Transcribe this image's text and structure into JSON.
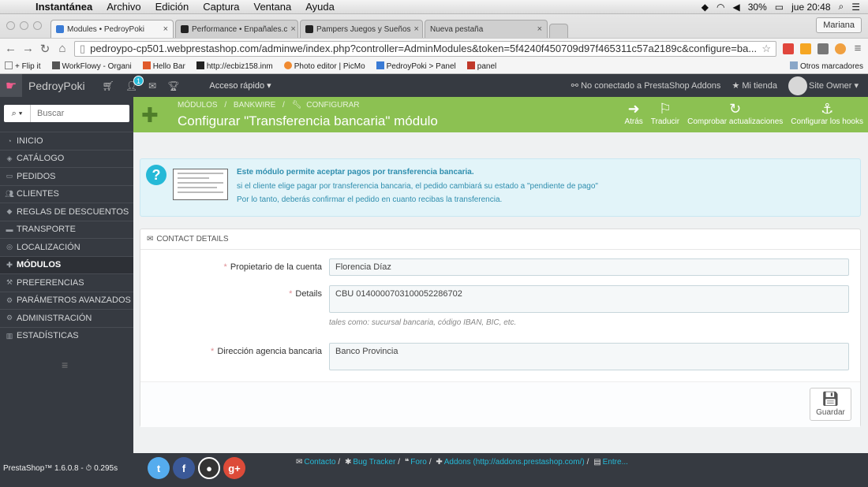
{
  "mac_menu": {
    "app": "Instantánea",
    "items": [
      "Archivo",
      "Edición",
      "Captura",
      "Ventana",
      "Ayuda"
    ],
    "battery": "30%",
    "clock": "jue 20:48"
  },
  "browser": {
    "tabs": [
      {
        "label": "Modules • PedroyPoki",
        "active": true
      },
      {
        "label": "Performance • Enpañales.c",
        "active": false
      },
      {
        "label": "Pampers Juegos y Sueños",
        "active": false
      },
      {
        "label": "Nueva pestaña",
        "active": false
      }
    ],
    "profile": "Mariana",
    "url": "pedroypo-cp501.webprestashop.com/adminwe/index.php?controller=AdminModules&token=5f4240f450709d97f465311c57a2189c&configure=ba...",
    "bookmarks": [
      "+ Flip it",
      "WorkFlowy - Organi",
      "Hello Bar",
      "http://ecbiz158.inm",
      "Photo editor | PicMo",
      "PedroyPoki > Panel",
      "panel"
    ],
    "other_bookmarks": "Otros marcadores"
  },
  "ps_header": {
    "shop_name": "PedroyPoki",
    "badge_count": "1",
    "quick_access": "Acceso rápido",
    "addons_status": "No conectado a PrestaShop Addons",
    "my_shop": "Mi tienda",
    "user": "Site Owner"
  },
  "sidebar": {
    "search_placeholder": "Buscar",
    "items": [
      {
        "label": "INICIO",
        "icon": "dashboard-icon"
      },
      {
        "label": "CATÁLOGO",
        "icon": "tag-icon"
      },
      {
        "label": "PEDIDOS",
        "icon": "credit-card-icon"
      },
      {
        "label": "CLIENTES",
        "icon": "users-icon"
      },
      {
        "label": "REGLAS DE DESCUENTOS",
        "icon": "ticket-icon"
      },
      {
        "label": "TRANSPORTE",
        "icon": "truck-icon"
      },
      {
        "label": "LOCALIZACIÓN",
        "icon": "globe-icon"
      },
      {
        "label": "MÓDULOS",
        "icon": "puzzle-icon"
      },
      {
        "label": "PREFERENCIAS",
        "icon": "wrench-icon"
      },
      {
        "label": "PARÁMETROS AVANZADOS",
        "icon": "cogs-icon"
      },
      {
        "label": "ADMINISTRACIÓN",
        "icon": "cog-icon"
      },
      {
        "label": "ESTADÍSTICAS",
        "icon": "bar-chart-icon"
      }
    ],
    "active_index": 7
  },
  "toolbar": {
    "breadcrumb": [
      "MÓDULOS",
      "/",
      "BANKWIRE",
      "/",
      "CONFIGURAR"
    ],
    "title": "Configurar \"Transferencia bancaria\" módulo",
    "buttons": [
      {
        "label": "Atrás",
        "icon": "arrow-left-circle-icon"
      },
      {
        "label": "Traducir",
        "icon": "flag-icon"
      },
      {
        "label": "Comprobar actualizaciones",
        "icon": "refresh-icon"
      },
      {
        "label": "Configurar los hooks",
        "icon": "anchor-icon"
      }
    ]
  },
  "info": {
    "line1": "Este módulo permite aceptar pagos por transferencia bancaria.",
    "line2": "si el cliente elige pagar por transferencia bancaria, el pedido cambiará su estado a \"pendiente de pago\"",
    "line3": "Por lo tanto, deberás confirmar el pedido en cuanto recibas la transferencia."
  },
  "form": {
    "heading": "CONTACT DETAILS",
    "owner_label": "Propietario de la cuenta",
    "owner_value": "Florencia Díaz",
    "details_label": "Details",
    "details_value": "CBU 0140000703100052286702",
    "details_help": "tales como: sucursal bancaria, código IBAN, BIC, etc.",
    "address_label": "Dirección agencia bancaria",
    "address_value": "Banco Provincia",
    "save_label": "Guardar"
  },
  "footer": {
    "version": "PrestaShop™ 1.6.0.8 - ⏱ 0.295s",
    "links": [
      {
        "label": "Contacto",
        "icon": "envelope-icon"
      },
      {
        "label": "Bug Tracker",
        "icon": "bug-icon"
      },
      {
        "label": "Foro",
        "icon": "comments-icon"
      },
      {
        "label": "Addons (http://addons.prestashop.com/)",
        "icon": "puzzle-icon"
      },
      {
        "label": "Entre...",
        "icon": "book-icon"
      }
    ]
  },
  "colors": {
    "toolbar_green": "#8cc152",
    "sidebar_dark": "#363a41",
    "info_blue": "#25b9d7"
  }
}
